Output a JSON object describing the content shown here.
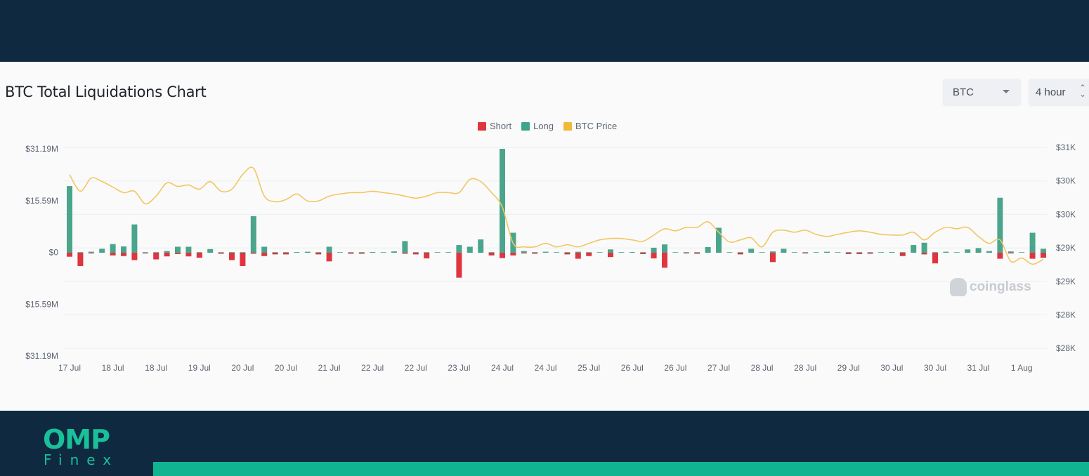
{
  "header": {
    "title": "BTC Total Liquidations Chart"
  },
  "controls": {
    "coin": "BTC",
    "interval": "4 hour"
  },
  "legend": [
    {
      "label": "Short",
      "color": "#e0353f"
    },
    {
      "label": "Long",
      "color": "#3fa58a"
    },
    {
      "label": "BTC Price",
      "color": "#f0b93a"
    }
  ],
  "watermark": "coinglass",
  "branding": {
    "logo_top": "OMP",
    "logo_bottom": "Finex"
  },
  "colors": {
    "short": "#e0353f",
    "long": "#4aa58c",
    "price": "#f2c763",
    "accent": "#11b491",
    "dark": "#0f2a40"
  },
  "chart_data": {
    "type": "bar",
    "title": "BTC Total Liquidations Chart",
    "y_left": {
      "range": [
        -31.19,
        31.19
      ],
      "unit": "$M",
      "tick_labels": [
        "$31.19M",
        "$15.59M",
        "$0",
        "$15.59M",
        "$31.19M"
      ]
    },
    "y_right": {
      "range": [
        28000,
        31000
      ],
      "tick_labels": [
        "$31K",
        "$30K",
        "$30K",
        "$29K",
        "$29K",
        "$28K",
        "$28K"
      ]
    },
    "x_tick_labels": [
      "17 Jul",
      "18 Jul",
      "18 Jul",
      "19 Jul",
      "20 Jul",
      "20 Jul",
      "21 Jul",
      "22 Jul",
      "22 Jul",
      "23 Jul",
      "24 Jul",
      "24 Jul",
      "25 Jul",
      "26 Jul",
      "26 Jul",
      "27 Jul",
      "28 Jul",
      "28 Jul",
      "29 Jul",
      "30 Jul",
      "30 Jul",
      "31 Jul",
      "1 Aug"
    ],
    "grid": true,
    "legend_position": "top-center",
    "series": [
      {
        "name": "Long",
        "type": "bar",
        "values": [
          20.0,
          0,
          0.3,
          1.2,
          2.6,
          1.9,
          8.5,
          0,
          0,
          0.5,
          1.8,
          1.8,
          0,
          1.1,
          0,
          0,
          0,
          11.0,
          1.8,
          0,
          0,
          0.2,
          0.3,
          0,
          1.8,
          0.1,
          0,
          0,
          0.2,
          0.1,
          0.4,
          3.5,
          0,
          0,
          0.1,
          0.1,
          2.3,
          1.8,
          4.0,
          0,
          31.19,
          6.0,
          0.5,
          0,
          0.3,
          0.1,
          0,
          0.3,
          0,
          0.1,
          1.0,
          0.1,
          0.2,
          0,
          1.5,
          2.5,
          0.1,
          0,
          0,
          1.7,
          7.5,
          0,
          0,
          1.2,
          0.1,
          0.4,
          1.2,
          0.1,
          0,
          0.1,
          0.3,
          0,
          0,
          0,
          0,
          0.1,
          0.2,
          0,
          2.3,
          3.0,
          0,
          0.3,
          0.1,
          1.0,
          1.4,
          0.5,
          16.5,
          0.4,
          0,
          6.0,
          1.2
        ]
      },
      {
        "name": "Short",
        "type": "bar",
        "values": [
          1.2,
          4.0,
          0.2,
          0,
          0.8,
          1.0,
          2.2,
          0.2,
          2.0,
          1.1,
          0.4,
          1.1,
          1.5,
          0,
          0.3,
          2.2,
          4.0,
          0.3,
          1.0,
          0.5,
          0.5,
          0,
          0,
          0.5,
          2.6,
          0,
          0.3,
          0.3,
          0,
          0,
          0,
          0.3,
          0.5,
          1.7,
          0,
          0,
          7.5,
          0,
          0,
          0.8,
          1.6,
          0.8,
          0.2,
          0.3,
          0,
          0,
          0.5,
          1.8,
          1.0,
          0,
          1.3,
          0,
          0,
          0.4,
          1.7,
          4.5,
          0,
          0.2,
          0.3,
          0,
          0,
          0,
          0.5,
          0,
          0,
          2.8,
          0,
          0,
          0.2,
          0,
          0,
          0,
          0.4,
          0.4,
          0.3,
          0,
          0,
          1.0,
          0,
          0.5,
          3.2,
          0,
          0,
          0,
          0,
          0,
          1.8,
          0.2,
          0,
          1.8,
          1.5
        ]
      },
      {
        "name": "BTC Price",
        "type": "line",
        "values": [
          30630,
          30390,
          30580,
          30530,
          30450,
          30370,
          30390,
          30210,
          30320,
          30510,
          30460,
          30480,
          30420,
          30530,
          30390,
          30420,
          30630,
          30720,
          30320,
          30240,
          30270,
          30350,
          30250,
          30250,
          30320,
          30350,
          30370,
          30370,
          30390,
          30370,
          30350,
          30320,
          30290,
          30320,
          30370,
          30370,
          30370,
          30560,
          30530,
          30370,
          30160,
          29640,
          29590,
          29590,
          29640,
          29590,
          29620,
          29590,
          29640,
          29690,
          29710,
          29710,
          29690,
          29670,
          29760,
          29850,
          29820,
          29870,
          29870,
          29950,
          29800,
          29660,
          29690,
          29720,
          29590,
          29800,
          29830,
          29800,
          29830,
          29770,
          29740,
          29770,
          29800,
          29820,
          29800,
          29770,
          29760,
          29760,
          29800,
          29690,
          29800,
          29870,
          29850,
          29870,
          29740,
          29640,
          29690,
          29380,
          29430,
          29340,
          29410
        ]
      }
    ]
  }
}
